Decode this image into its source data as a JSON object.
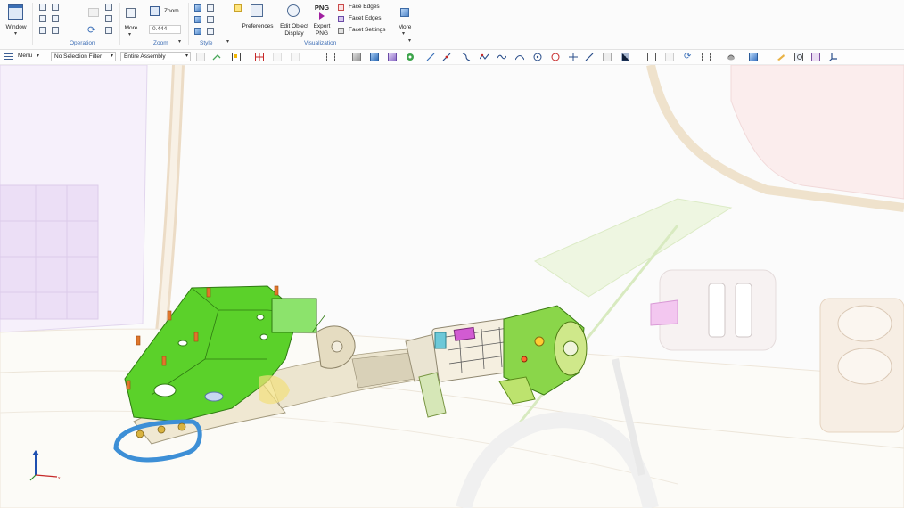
{
  "ribbon": {
    "window_label": "Window",
    "operation_label": "Operation",
    "zoom_button": "Zoom",
    "zoom_value": "0.444",
    "zoom_group_label": "Zoom",
    "more_label": "More",
    "style_label": "Style",
    "preferences_label": "Preferences",
    "edit_object_display_label": "Edit Object Display",
    "export_png_label": "Export PNG",
    "png_badge": "PNG",
    "face_edges_label": "Face Edges",
    "facet_edges_label": "Facet Edges",
    "facet_settings_label": "Facet Settings",
    "visualization_label": "Visualization",
    "more2_label": "More"
  },
  "toolbar": {
    "menu_label": "Menu",
    "selection_filter": "No Selection Filter",
    "assembly_scope": "Entire Assembly"
  },
  "colors": {
    "accent": "#3c6db5",
    "part_green": "#5bd12a",
    "bolt_orange": "#e0762b",
    "bracket_blue": "#3d8fd6"
  },
  "icons": [
    "window-icon",
    "refresh-icon",
    "zoom-icon",
    "style-cube-icon",
    "preferences-icon",
    "edit-display-icon",
    "png-export-icon",
    "face-edges-icon",
    "facet-edges-icon",
    "facet-settings-icon",
    "menu-icon",
    "snap-icon",
    "triad-icon"
  ]
}
